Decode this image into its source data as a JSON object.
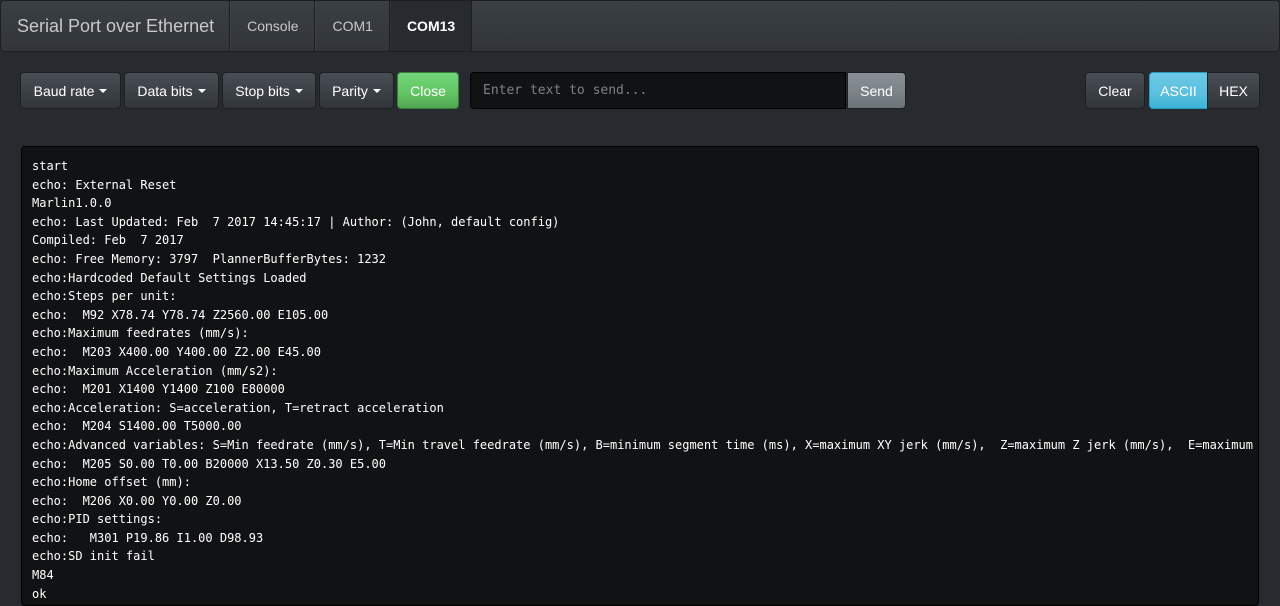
{
  "navbar": {
    "brand": "Serial Port over Ethernet",
    "tabs": [
      {
        "label": "Console",
        "active": false
      },
      {
        "label": "COM1",
        "active": false
      },
      {
        "label": "COM13",
        "active": true
      }
    ]
  },
  "toolbar": {
    "baud_rate_label": "Baud rate",
    "data_bits_label": "Data bits",
    "stop_bits_label": "Stop bits",
    "parity_label": "Parity",
    "close_label": "Close",
    "send_input_value": "",
    "send_input_placeholder": "Enter text to send...",
    "send_label": "Send",
    "clear_label": "Clear",
    "ascii_label": "ASCII",
    "hex_label": "HEX",
    "selected_mode": "ASCII"
  },
  "console": {
    "lines": [
      "start",
      "echo: External Reset",
      "Marlin1.0.0",
      "echo: Last Updated: Feb  7 2017 14:45:17 | Author: (John, default config)",
      "Compiled: Feb  7 2017",
      "echo: Free Memory: 3797  PlannerBufferBytes: 1232",
      "echo:Hardcoded Default Settings Loaded",
      "echo:Steps per unit:",
      "echo:  M92 X78.74 Y78.74 Z2560.00 E105.00",
      "echo:Maximum feedrates (mm/s):",
      "echo:  M203 X400.00 Y400.00 Z2.00 E45.00",
      "echo:Maximum Acceleration (mm/s2):",
      "echo:  M201 X1400 Y1400 Z100 E80000",
      "echo:Acceleration: S=acceleration, T=retract acceleration",
      "echo:  M204 S1400.00 T5000.00",
      "echo:Advanced variables: S=Min feedrate (mm/s), T=Min travel feedrate (mm/s), B=minimum segment time (ms), X=maximum XY jerk (mm/s),  Z=maximum Z jerk (mm/s),  E=maximum E jerk (mm/s)",
      "echo:  M205 S0.00 T0.00 B20000 X13.50 Z0.30 E5.00",
      "echo:Home offset (mm):",
      "echo:  M206 X0.00 Y0.00 Z0.00",
      "echo:PID settings:",
      "echo:   M301 P19.86 I1.00 D98.93",
      "echo:SD init fail",
      "M84",
      "ok"
    ]
  },
  "colors": {
    "background": "#272b30",
    "success": "#62c462",
    "info": "#5bc0de",
    "console_bg": "#111214"
  }
}
